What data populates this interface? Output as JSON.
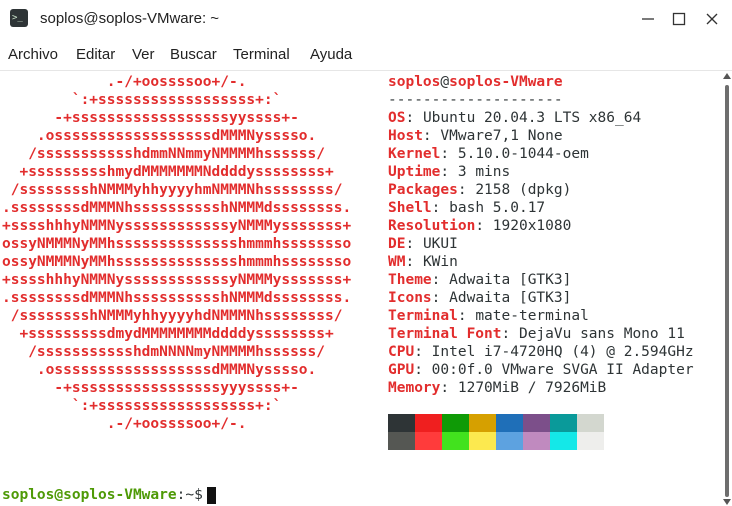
{
  "window": {
    "title": "soplos@soplos-VMware: ~",
    "icon": "terminal-icon"
  },
  "menu": [
    "Archivo",
    "Editar",
    "Ver",
    "Buscar",
    "Terminal",
    "Ayuda"
  ],
  "ascii_lines": [
    "            .-/+oossssoo+/-.",
    "        `:+ssssssssssssssssss+:`",
    "      -+ssssssssssssssssssyyssss+-",
    "    .ossssssssssssssssssdMMMNysssso.",
    "   /ssssssssssshdmmNNmmyNMMMMhssssss/",
    "  +ssssssssshmydMMMMMMMNddddyssssssss+",
    " /sssssssshNMMMyhhyyyyhmNMMMNhssssssss/",
    ".ssssssssdMMMNhsssssssssshNMMMdssssssss.",
    "+sssshhhyNMMNyssssssssssssyNMMMysssssss+",
    "ossyNMMMNyMMhsssssssssssssshmmmhssssssso",
    "ossyNMMMNyMMhsssssssssssssshmmmhssssssso",
    "+sssshhhyNMMNyssssssssssssyNMMMysssssss+",
    ".ssssssssdMMMNhsssssssssshNMMMdssssssss.",
    " /sssssssshNMMMyhhyyyyhdNMMMNhssssssss/",
    "  +sssssssssdmydMMMMMMMMddddyssssssss+",
    "   /ssssssssssshdmNNNNmyNMMMMhssssss/",
    "    .ossssssssssssssssssdMMMNysssso.",
    "      -+sssssssssssssssssyyyssss+-",
    "        `:+ssssssssssssssssss+:`",
    "            .-/+oossssoo+/-."
  ],
  "info": {
    "user": "soplos",
    "at": "@",
    "host": "soplos-VMware",
    "separator": "--------------------",
    "rows": [
      {
        "key": "OS",
        "value": "Ubuntu 20.04.3 LTS x86_64"
      },
      {
        "key": "Host",
        "value": "VMware7,1 None"
      },
      {
        "key": "Kernel",
        "value": "5.10.0-1044-oem"
      },
      {
        "key": "Uptime",
        "value": "3 mins"
      },
      {
        "key": "Packages",
        "value": "2158 (dpkg)"
      },
      {
        "key": "Shell",
        "value": "bash 5.0.17"
      },
      {
        "key": "Resolution",
        "value": "1920x1080"
      },
      {
        "key": "DE",
        "value": "UKUI"
      },
      {
        "key": "WM",
        "value": "KWin"
      },
      {
        "key": "Theme",
        "value": "Adwaita [GTK3]"
      },
      {
        "key": "Icons",
        "value": "Adwaita [GTK3]"
      },
      {
        "key": "Terminal",
        "value": "mate-terminal"
      },
      {
        "key": "Terminal Font",
        "value": "DejaVu sans Mono 11"
      },
      {
        "key": "CPU",
        "value": "Intel i7-4720HQ (4) @ 2.594GHz"
      },
      {
        "key": "GPU",
        "value": "00:0f.0 VMware SVGA II Adapter"
      },
      {
        "key": "Memory",
        "value": "1270MiB / 7926MiB"
      }
    ]
  },
  "palette": {
    "dark": [
      "#2e3436",
      "#ef1f1f",
      "#0f9a06",
      "#d6a000",
      "#1f6fb8",
      "#7c4f8a",
      "#0a9a9a",
      "#d3d7cf"
    ],
    "light": [
      "#555753",
      "#ff3b3b",
      "#42e21e",
      "#fce94f",
      "#5da2e0",
      "#c08abf",
      "#14e8e8",
      "#eeeeec"
    ]
  },
  "prompt": {
    "user_host": "soplos@soplos-VMware",
    "path": ":~$"
  },
  "colors": {
    "accent_red": "#e22d2d",
    "prompt_green": "#4e9a06",
    "text": "#2e3436"
  }
}
